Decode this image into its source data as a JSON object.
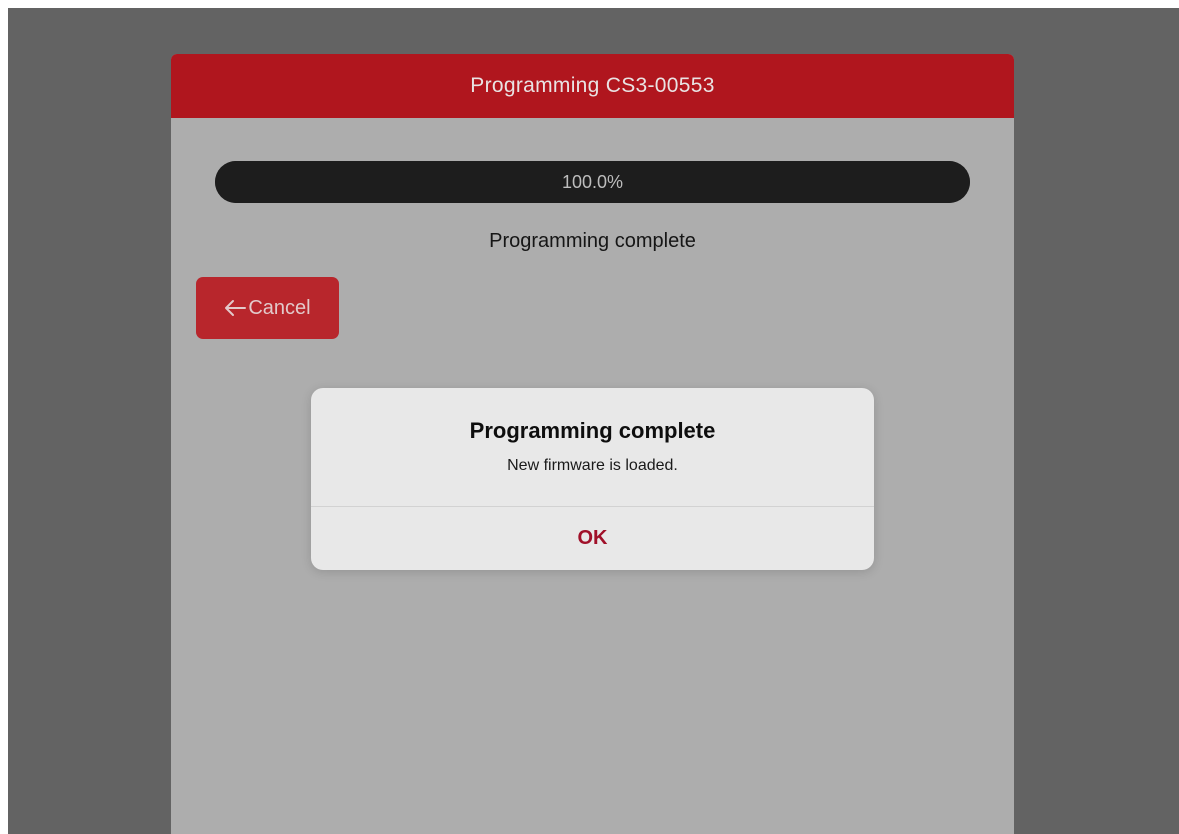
{
  "header": {
    "title": "Programming CS3-00553"
  },
  "progress": {
    "label": "100.0%",
    "fraction": 1.0
  },
  "status": {
    "text": "Programming complete"
  },
  "cancel": {
    "label": "Cancel",
    "icon": "arrow-left-icon"
  },
  "dialog": {
    "title": "Programming complete",
    "message": "New firmware is loaded.",
    "ok_label": "OK"
  },
  "colors": {
    "header": "#b0161e",
    "cancel_button": "#b8262c",
    "ok_text": "#a01029",
    "progress_track": "#1d1d1d"
  }
}
